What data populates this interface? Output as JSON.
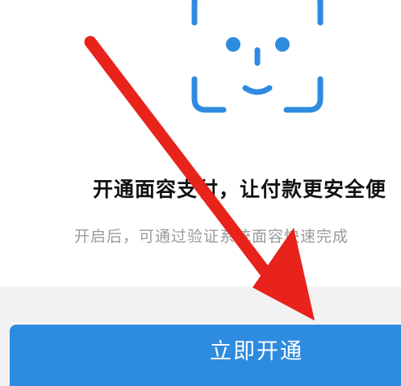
{
  "face_setup": {
    "icon": "face-id-icon",
    "headline": "开通面容支付，让付款更安全便",
    "description": "开启后，可通过验证系统面容快速完成",
    "enable_button_label": "立即开通"
  },
  "colors": {
    "accent_blue": "#2d8be0",
    "headline": "#111111",
    "description": "#9a9a9a",
    "annotation_arrow": "#e8231c",
    "footer_background": "#f2f2f2"
  }
}
